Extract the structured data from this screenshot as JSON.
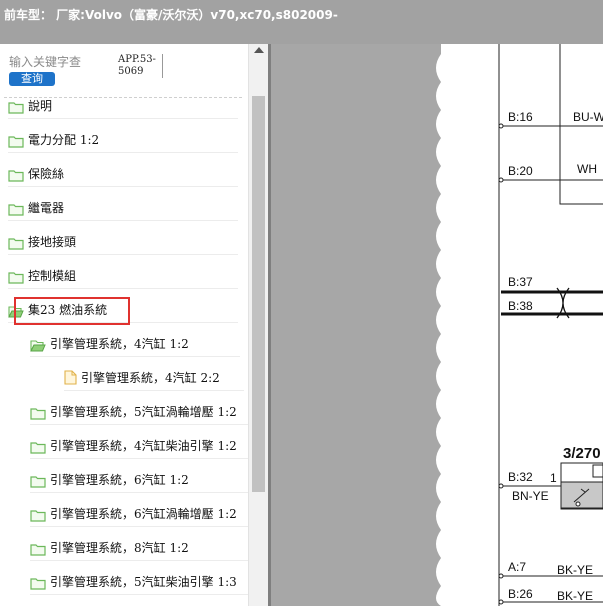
{
  "title": "前车型：  厂家:Volvo（富豪/沃尔沃）v70,xc70,s802009-",
  "search": {
    "placeholder": "输入关键字查",
    "button": "查询"
  },
  "app_code": {
    "line1": "APP.53-",
    "line2": "5069"
  },
  "tree": [
    {
      "label": "說明",
      "icon": "folder-icon",
      "open": false
    },
    {
      "label": "電力分配 1:2",
      "icon": "folder-icon",
      "open": false
    },
    {
      "label": "保險絲",
      "icon": "folder-icon",
      "open": false
    },
    {
      "label": "繼電器",
      "icon": "folder-icon",
      "open": false
    },
    {
      "label": "接地接頭",
      "icon": "folder-icon",
      "open": false
    },
    {
      "label": "控制模組",
      "icon": "folder-icon",
      "open": false
    },
    {
      "label": "集23 燃油系統",
      "icon": "folder-open-icon",
      "open": true
    },
    {
      "label": "引擎管理系統，4汽缸 1:2",
      "icon": "folder-open-icon",
      "open": true
    },
    {
      "label": "引擎管理系統，4汽缸 2:2",
      "icon": "file-icon",
      "open": false
    },
    {
      "label": "引擎管理系統，5汽缸渦輪增壓 1:2",
      "icon": "folder-icon",
      "open": false
    },
    {
      "label": "引擎管理系統，4汽缸柴油引擎 1:2",
      "icon": "folder-icon",
      "open": false
    },
    {
      "label": "引擎管理系統，6汽缸 1:2",
      "icon": "folder-icon",
      "open": false
    },
    {
      "label": "引擎管理系統，6汽缸渦輪增壓 1:2",
      "icon": "folder-icon",
      "open": false
    },
    {
      "label": "引擎管理系統，8汽缸 1:2",
      "icon": "folder-icon",
      "open": false
    },
    {
      "label": "引擎管理系統，5汽缸柴油引擎 1:3",
      "icon": "folder-icon",
      "open": false
    }
  ],
  "diagram": {
    "pins": [
      "B:16",
      "B:20",
      "B:37",
      "B:38",
      "B:32",
      "A:7",
      "B:26"
    ],
    "wires": [
      "BU-W",
      "WH",
      "BN-YE",
      "BK-YE",
      "BK-YE"
    ],
    "component": "3/270",
    "pin_number": "1"
  },
  "colors": {
    "titlebar": "#a2a2a2",
    "button": "#1e73c9",
    "highlight": "#e0322f",
    "folder": "#7cc46a",
    "scroll_strip": "#a7a7a7"
  }
}
